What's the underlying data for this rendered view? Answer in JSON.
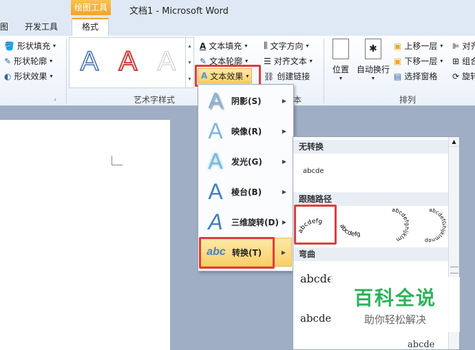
{
  "titlebar": {
    "context_group": "绘图工具",
    "doc_title": "文档1 - Microsoft Word"
  },
  "tabs": {
    "partial": "图",
    "developer": "开发工具",
    "format": "格式"
  },
  "ribbon": {
    "shape_fill": "形状填充",
    "shape_outline": "形状轮廓",
    "shape_effects": "形状效果",
    "text_fill": "文本填充",
    "text_outline": "文本轮廓",
    "text_effects": "文本效果",
    "text_direction": "文字方向",
    "align_text": "对齐文本",
    "create_link": "创建链接",
    "position": "位置",
    "auto_wrap": "自动换行",
    "bring_forward": "上移一层",
    "send_backward": "下移一层",
    "selection_pane": "选择窗格",
    "align_partial": "对齐",
    "group_partial": "组合",
    "rotate_partial": "旋转",
    "wordart_styles_label": "艺术字样式",
    "text_group_partial": "本",
    "arrange_label": "排列",
    "wordart_glyph": "A"
  },
  "menu": {
    "items": [
      {
        "label": "阴影(S)"
      },
      {
        "label": "映像(R)"
      },
      {
        "label": "发光(G)"
      },
      {
        "label": "棱台(B)"
      },
      {
        "label": "三维旋转(D)"
      },
      {
        "label": "转换(T)"
      }
    ]
  },
  "gallery": {
    "no_transform": "无转换",
    "sample": "abcde",
    "follow_path": "跟随路径",
    "warp": "弯曲",
    "arc_up": "abcdefg",
    "arc_down": "abcdefg",
    "circle": "abcdefghijklm",
    "button": "abcdefGhijklmnop",
    "warp1": "abcde",
    "warp2": "abcde",
    "warp3": "abcde"
  },
  "watermark": {
    "title": "百科全说",
    "subtitle": "助你轻松解决"
  }
}
